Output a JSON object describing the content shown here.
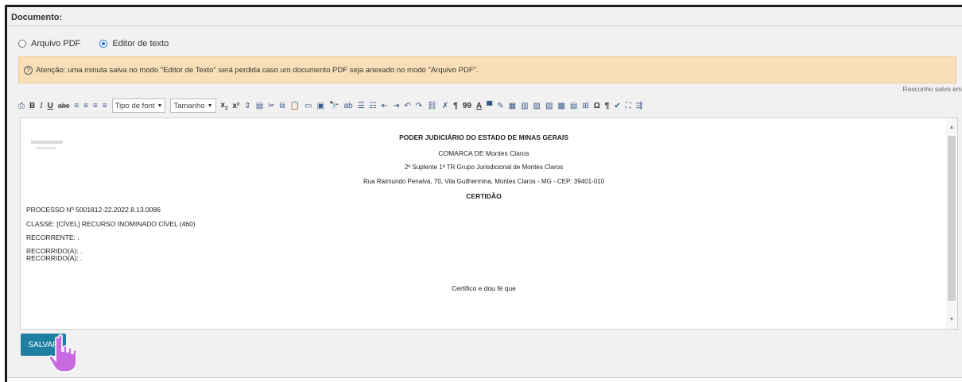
{
  "section_label": "Documento:",
  "mode": {
    "pdf_label": "Arquivo PDF",
    "editor_label": "Editor de texto",
    "selected": "editor"
  },
  "alert": {
    "icon": "question-circle-icon",
    "text": "Atenção: uma minuta salva no modo \"Editor de Texto\" será perdida caso um documento PDF seja anexado no modo \"Arquivo PDF\"."
  },
  "draft_status": "Rascunho salvo em",
  "toolbar": {
    "bold": "B",
    "italic": "I",
    "underline": "U",
    "strike": "abc",
    "font_family": "Tipo de font",
    "font_size": "Tamanho",
    "subscript": "x",
    "superscript": "x²",
    "blockquote": "99",
    "omega": "Ω",
    "pilcrow": "¶"
  },
  "document": {
    "header": [
      "PODER JUDICIÁRIO DO ESTADO DE MINAS GERAIS",
      "COMARCA DE Montes Claros",
      "2º Suplente 1ª TR Grupo Jurisdicional de Montes Claros",
      "Rua Raimundo Penalva, 70, Vila Guilhermina, Montes Claros - MG - CEP: 39401-010",
      "CERTIDÃO"
    ],
    "processo": "PROCESSO Nº 5001812-22.2022.8.13.0086",
    "classe": "CLASSE: [CÍVEL] RECURSO INOMINADO CÍVEL (460)",
    "recorrente": "RECORRENTE: .",
    "recorrido_1": "RECORRIDO(A): .",
    "recorrido_2": "RECORRIDO(A): .",
    "body": "Certifico e dou fé que"
  },
  "save_label": "SALVAR",
  "colors": {
    "alert_bg": "#f8dfb7",
    "save_bg": "#1f7fa0",
    "radio_accent": "#1d6fd6"
  }
}
